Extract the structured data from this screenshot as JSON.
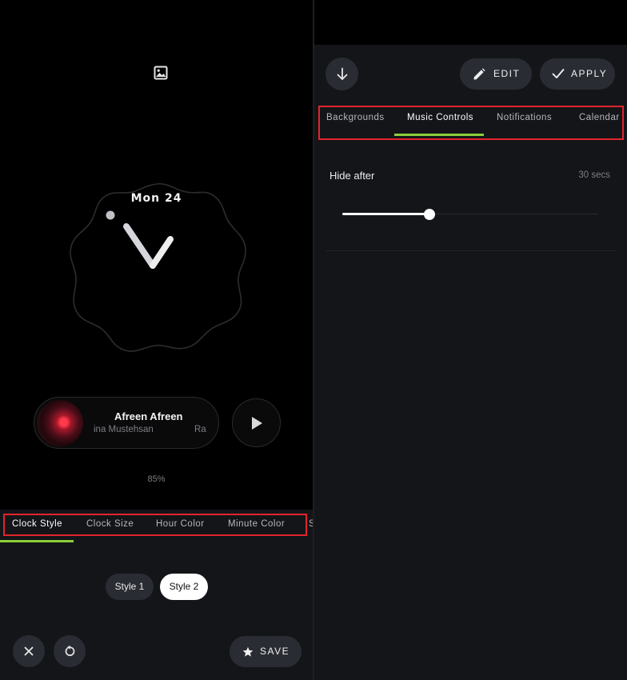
{
  "clock_preview": {
    "date": "Mon 24",
    "media": {
      "title": "Afreen Afreen",
      "artist": "ina Mustehsan",
      "extra": "Ra"
    },
    "battery": "85%"
  },
  "clock_tabs": [
    "Clock Style",
    "Clock Size",
    "Hour Color",
    "Minute Color",
    "S"
  ],
  "style_options": [
    "Style 1",
    "Style 2"
  ],
  "selected_style": "Style 2",
  "bottom_bar": {
    "save_label": "SAVE"
  },
  "top_bar": {
    "edit_label": "EDIT",
    "apply_label": "APPLY"
  },
  "settings_tabs": [
    "Backgrounds",
    "Music Controls",
    "Notifications",
    "Calendar"
  ],
  "active_settings_tab": "Music Controls",
  "hide_after": {
    "label": "Hide after",
    "value": "30 secs",
    "slider_fraction": 0.34
  },
  "colors": {
    "accent": "#8bcf3a",
    "highlight_box": "#e1252c",
    "button_bg": "#2a2c33",
    "panel_bg": "#141519"
  },
  "icons": [
    "image-icon",
    "play-icon",
    "close-icon",
    "reset-icon",
    "star-icon",
    "arrow-down-icon",
    "pencil-icon",
    "check-icon"
  ]
}
